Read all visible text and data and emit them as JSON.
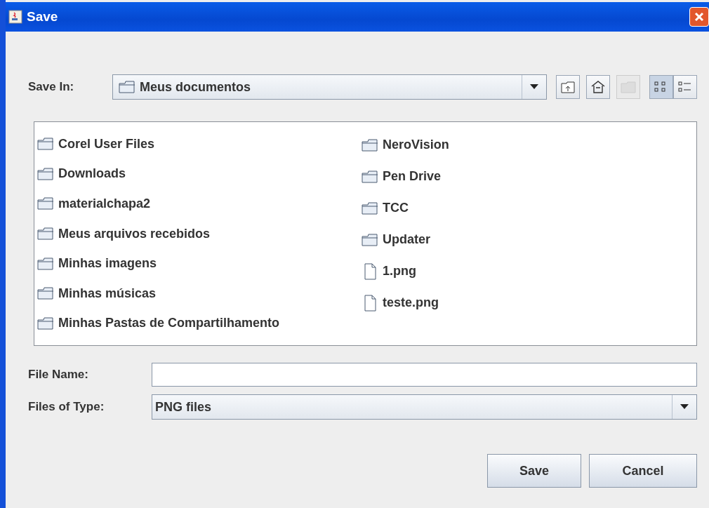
{
  "window": {
    "title": "Save"
  },
  "save_in": {
    "label": "Save In:",
    "value": "Meus documentos"
  },
  "toolbar": [
    {
      "kind": "up",
      "disabled": false,
      "selected": false
    },
    {
      "kind": "home",
      "disabled": false,
      "selected": false
    },
    {
      "kind": "new-folder",
      "disabled": true,
      "selected": false
    },
    {
      "kind": "list",
      "disabled": false,
      "selected": true
    },
    {
      "kind": "details",
      "disabled": false,
      "selected": false
    }
  ],
  "files": [
    [
      {
        "kind": "folder",
        "name": "Corel User Files"
      },
      {
        "kind": "folder",
        "name": "Downloads"
      },
      {
        "kind": "folder",
        "name": "materialchapa2"
      },
      {
        "kind": "folder",
        "name": "Meus arquivos recebidos"
      },
      {
        "kind": "folder",
        "name": "Minhas imagens"
      },
      {
        "kind": "folder",
        "name": "Minhas músicas"
      },
      {
        "kind": "folder",
        "name": "Minhas Pastas de Compartilhamento"
      }
    ],
    [
      {
        "kind": "folder",
        "name": "NeroVision"
      },
      {
        "kind": "folder",
        "name": "Pen Drive"
      },
      {
        "kind": "folder",
        "name": "TCC"
      },
      {
        "kind": "folder",
        "name": "Updater"
      },
      {
        "kind": "file",
        "name": "1.png"
      },
      {
        "kind": "file",
        "name": "teste.png"
      }
    ]
  ],
  "file_name": {
    "label": "File Name:"
  },
  "file_type": {
    "label": "Files of Type:",
    "value": "PNG files"
  },
  "buttons": [
    "Save",
    "Cancel"
  ]
}
